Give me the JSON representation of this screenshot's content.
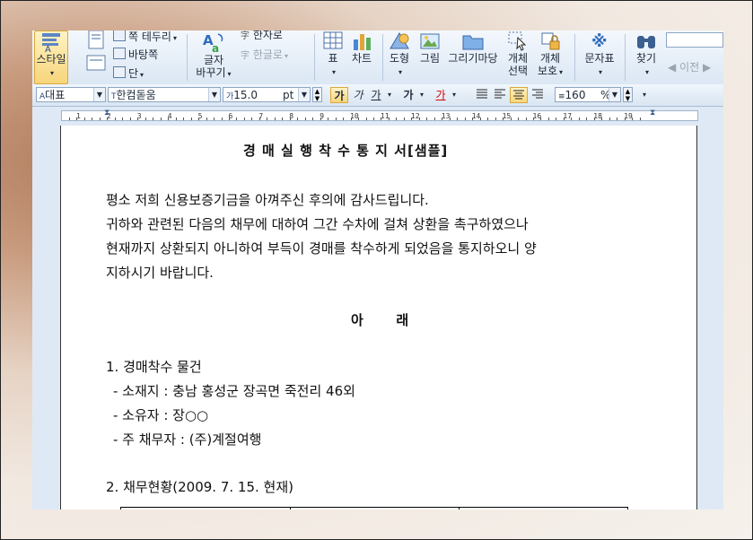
{
  "ribbon": {
    "style_label": "스타일",
    "para_list_label": "쪽 테두리",
    "page_bg_label": "바탕쪽",
    "columns_label": "단",
    "char_change_label_1": "글자",
    "char_change_label_2": "바꾸기",
    "hanja_label": "한자로",
    "hangul_label": "한글로",
    "table_label": "표",
    "chart_label": "차트",
    "shape_label": "도형",
    "picture_label": "그림",
    "drawing_label": "그리기마당",
    "obj_select_1": "개체",
    "obj_select_2": "선택",
    "obj_protect_1": "개체",
    "obj_protect_2": "보호",
    "symbol_label": "문자표",
    "find_label": "찾기",
    "prev_label": "이전"
  },
  "format_bar": {
    "style_value": "대표",
    "font_value": "한컴돋움",
    "size_value": "15.0",
    "size_unit": "pt",
    "bold": "가",
    "italic": "가",
    "underline": "가",
    "outline": "가",
    "color": "가",
    "line_spacing": "160",
    "line_spacing_unit": "%"
  },
  "ruler": {
    "numbers": [
      "1",
      "2",
      "3",
      "4",
      "5",
      "6",
      "7",
      "8",
      "9",
      "10",
      "11",
      "12",
      "13",
      "14",
      "15",
      "16",
      "17",
      "18",
      "19"
    ]
  },
  "document": {
    "title": "경 매 실 행 착 수 통 지 서[샘플]",
    "para1": "평소 저희 신용보증기금을 아껴주신 후의에 감사드립니다.",
    "para2": "귀하와 관련된 다음의 채무에 대하여 그간 수차에 걸쳐 상환을 촉구하였으나",
    "para3": "현재까지 상환되지 아니하여 부득이 경매를 착수하게 되었음을 통지하오니 양",
    "para4": "지하시기 바랍니다.",
    "center_heading": "아       래",
    "item1_heading": "1. 경매착수 물건",
    "item1_location": "- 소재지 : 충남 홍성군 장곡면 죽전리 46외",
    "item1_owner": "- 소유자 : 장○○",
    "item1_debtor": "- 주 채무자 : (주)계절여행",
    "item2_heading": "2. 채무현황(2009. 7. 15. 현재)"
  },
  "colors": {
    "ribbon_bg": "#dbe7f4",
    "active_yellow": "#f7d57a",
    "font_color_red": "#d40000"
  }
}
